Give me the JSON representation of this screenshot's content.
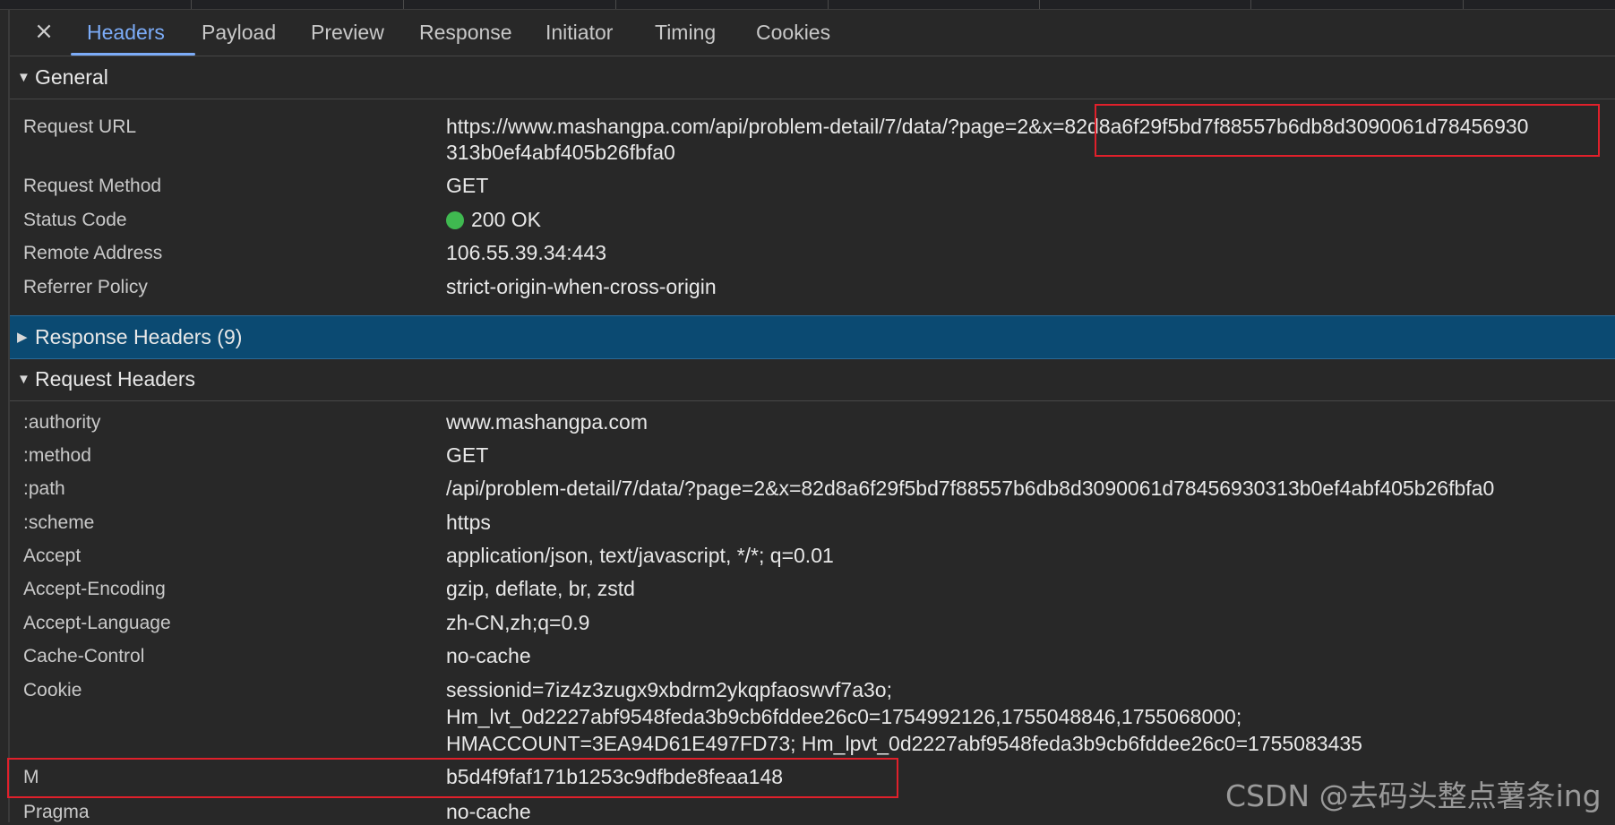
{
  "tabs": [
    {
      "label": "Headers",
      "active": true
    },
    {
      "label": "Payload"
    },
    {
      "label": "Preview"
    },
    {
      "label": "Response"
    },
    {
      "label": "Initiator"
    },
    {
      "label": "Timing"
    },
    {
      "label": "Cookies"
    }
  ],
  "close_icon": "×",
  "general": {
    "title": "General",
    "request_url_label": "Request URL",
    "request_url_line1": "https://www.mashangpa.com/api/problem-detail/7/data/?page=2&x=82d8a6f29f5bd7f88557b6db8d3090061d78456930",
    "request_url_line2": "313b0ef4abf405b26fbfa0",
    "request_method_label": "Request Method",
    "request_method": "GET",
    "status_code_label": "Status Code",
    "status_code": "200 OK",
    "status_color": "#3fb950",
    "remote_address_label": "Remote Address",
    "remote_address": "106.55.39.34:443",
    "referrer_policy_label": "Referrer Policy",
    "referrer_policy": "strict-origin-when-cross-origin"
  },
  "response_headers": {
    "title": "Response Headers (9)"
  },
  "request_headers": {
    "title": "Request Headers",
    "rows": [
      {
        "key": ":authority",
        "value": "www.mashangpa.com"
      },
      {
        "key": ":method",
        "value": "GET"
      },
      {
        "key": ":path",
        "value": "/api/problem-detail/7/data/?page=2&x=82d8a6f29f5bd7f88557b6db8d3090061d78456930313b0ef4abf405b26fbfa0"
      },
      {
        "key": ":scheme",
        "value": "https"
      },
      {
        "key": "Accept",
        "value": "application/json, text/javascript, */*; q=0.01"
      },
      {
        "key": "Accept-Encoding",
        "value": "gzip, deflate, br, zstd"
      },
      {
        "key": "Accept-Language",
        "value": "zh-CN,zh;q=0.9"
      },
      {
        "key": "Cache-Control",
        "value": "no-cache"
      }
    ],
    "cookie_label": "Cookie",
    "cookie_lines": [
      "sessionid=7iz4z3zugx9xbdrm2ykqpfaoswvf7a3o;",
      "Hm_lvt_0d2227abf9548feda3b9cb6fddee26c0=1754992126,1755048846,1755068000;",
      "HMACCOUNT=3EA94D61E497FD73; Hm_lpvt_0d2227abf9548feda3b9cb6fddee26c0=1755083435"
    ],
    "m_label": "M",
    "m_value": "b5d4f9faf171b1253c9dfbde8feaa148",
    "pragma_label": "Pragma",
    "pragma_value": "no-cache"
  },
  "highlight_color": "#e0202b",
  "watermark": "CSDN @去码头整点薯条ing"
}
